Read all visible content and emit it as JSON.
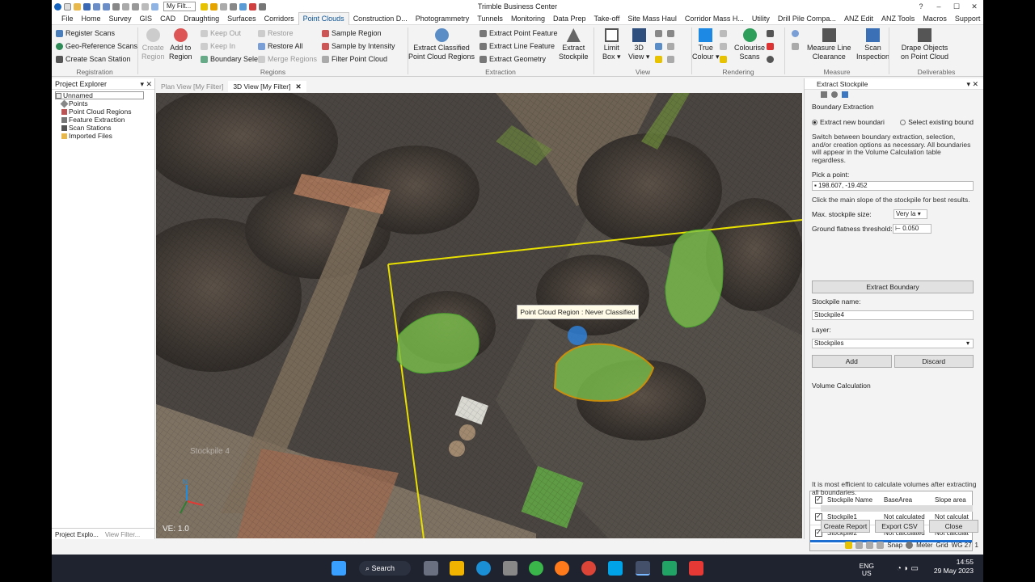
{
  "app": {
    "title": "Trimble Business Center",
    "filter_select": "My Filt...",
    "window_controls": [
      "?",
      "–",
      "☐",
      "✕"
    ]
  },
  "menu": {
    "file": "File",
    "tabs": [
      "Home",
      "Survey",
      "GIS",
      "CAD",
      "Draughting",
      "Surfaces",
      "Corridors",
      "Point Clouds",
      "Construction D...",
      "Photogrammetry",
      "Tunnels",
      "Monitoring",
      "Data Prep",
      "Take-off",
      "Site Mass Haul",
      "Corridor Mass H...",
      "Utility",
      "Drill Pile Compa...",
      "ANZ Edit",
      "ANZ Tools",
      "Macros",
      "Support"
    ],
    "active_tab": "Point Clouds"
  },
  "ribbon": {
    "registration": {
      "label": "Registration",
      "register_scans": "Register Scans",
      "geo_reference_scans": "Geo-Reference Scans",
      "create_scan_station": "Create Scan Station"
    },
    "regions": {
      "label": "Regions",
      "create_region": "Create\nRegion",
      "add_to_region": "Add to\nRegion",
      "keep_out": "Keep Out",
      "keep_in": "Keep In",
      "boundary_select": "Boundary Select",
      "restore": "Restore",
      "restore_all": "Restore All",
      "merge_regions": "Merge Regions",
      "sample_region": "Sample Region",
      "sample_by_intensity": "Sample by Intensity",
      "filter_point_cloud": "Filter Point Cloud"
    },
    "extraction": {
      "label": "Extraction",
      "extract_classified": "Extract Classified\nPoint Cloud Regions",
      "extract_point_feature": "Extract Point Feature",
      "extract_line_feature": "Extract Line Feature",
      "extract_geometry": "Extract Geometry",
      "extract_stockpile": "Extract\nStockpile"
    },
    "view": {
      "label": "View",
      "limit_box": "Limit\nBox ▾",
      "view_3d": "3D\nView ▾"
    },
    "rendering": {
      "label": "Rendering",
      "true_colour": "True\nColour ▾",
      "colourise_scans": "Colourise\nScans"
    },
    "measure": {
      "label": "Measure",
      "measure_line_clearance": "Measure Line\nClearance",
      "scan_inspection": "Scan\nInspection"
    },
    "deliverables": {
      "label": "Deliverables",
      "drape_objects": "Drape Objects\non Point Cloud"
    }
  },
  "project_explorer": {
    "title": "Project Explorer",
    "root": "Unnamed",
    "items": [
      "Points",
      "Point Cloud Regions",
      "Feature Extraction",
      "Scan Stations",
      "Imported Files"
    ],
    "bottom_tabs": [
      "Project Explo...",
      "View Filter..."
    ]
  },
  "view_tabs": [
    {
      "label": "Plan View [My Filter]",
      "active": false
    },
    {
      "label": "3D View [My Filter]",
      "active": true
    }
  ],
  "viewport": {
    "tooltip": "Point Cloud Region : Never Classified",
    "ve_label": "VE: 1.0",
    "stockpile_ghost_label": "Stockpile 4",
    "axis_n": "N"
  },
  "extract_stockpile": {
    "title": "Extract Stockpile",
    "section_boundary": "Boundary Extraction",
    "radio_new": "Extract new boundari",
    "radio_existing": "Select existing bound",
    "description": "Switch between boundary extraction, selection, and/or creation options as necessary. All boundaries will appear in the Volume Calculation table regardless.",
    "pick_point_label": "Pick a point:",
    "pick_point_value": "198.607, -19.452",
    "slope_hint": "Click the main slope of the stockpile for best results.",
    "max_size_label": "Max. stockpile size:",
    "max_size_value": "Very la",
    "flatness_label": "Ground flatness threshold:",
    "flatness_value": "0.050",
    "extract_boundary_btn": "Extract Boundary",
    "stockpile_name_label": "Stockpile name:",
    "stockpile_name_value": "Stockpile4",
    "layer_label": "Layer:",
    "layer_value": "Stockpiles",
    "add_btn": "Add",
    "discard_btn": "Discard",
    "volume_section": "Volume Calculation",
    "table_headers": [
      "Stockpile Name",
      "BaseArea",
      "Slope area"
    ],
    "table_rows": [
      {
        "name": "Stockpile1",
        "base": "Not calculated",
        "slope": "Not calculat"
      },
      {
        "name": "Stockpile2",
        "base": "Not calculated",
        "slope": "Not calculat"
      }
    ],
    "efficiency_note": "It is most efficient to calculate volumes after extracting all boundaries.",
    "create_report_btn": "Create Report",
    "export_csv_btn": "Export CSV",
    "close_btn": "Close"
  },
  "status": {
    "snap": "Snap",
    "units": "Meter",
    "grid": "Grid",
    "crs": "WG 27",
    "page": "1"
  },
  "taskbar": {
    "search": "Search",
    "lang": "ENG",
    "region": "US",
    "time": "14:55",
    "date": "29 May 2023"
  }
}
